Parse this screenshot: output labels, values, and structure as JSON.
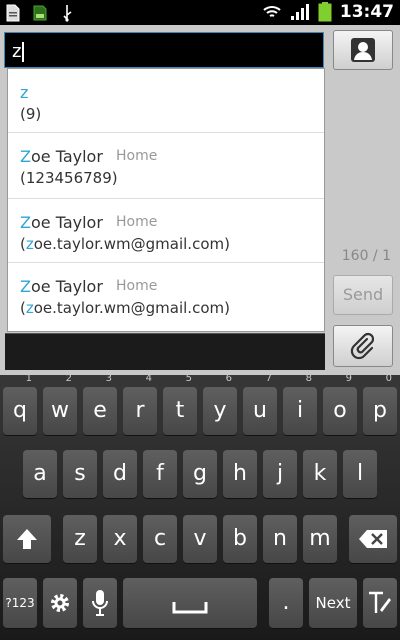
{
  "status_bar": {
    "time": "13:47",
    "icons": [
      "file-icon",
      "sd-card-icon",
      "usb-icon",
      "wifi-icon",
      "signal-icon",
      "battery-icon"
    ],
    "battery_color": "#7fd02f"
  },
  "compose": {
    "to_value": "z",
    "char_counter": "160 / 1",
    "send_label": "Send"
  },
  "suggestions": [
    {
      "match": "z",
      "name_rest": "",
      "type": "",
      "detail": "(9)",
      "detail_highlight": "",
      "detail_rest": ""
    },
    {
      "match": "Z",
      "name_rest": "oe Taylor",
      "type": "Home",
      "detail": "(123456789)",
      "detail_highlight": "",
      "detail_rest": ""
    },
    {
      "match": "Z",
      "name_rest": "oe Taylor",
      "type": "Home",
      "detail": "(",
      "detail_highlight": "z",
      "detail_rest": "oe.taylor.wm@gmail.com)"
    },
    {
      "match": "Z",
      "name_rest": "oe Taylor",
      "type": "Home",
      "detail": "(",
      "detail_highlight": "z",
      "detail_rest": "oe.taylor.wm@gmail.com)"
    }
  ],
  "keyboard": {
    "row1": [
      {
        "k": "q",
        "n": "1"
      },
      {
        "k": "w",
        "n": "2"
      },
      {
        "k": "e",
        "n": "3"
      },
      {
        "k": "r",
        "n": "4"
      },
      {
        "k": "t",
        "n": "5"
      },
      {
        "k": "y",
        "n": "6"
      },
      {
        "k": "u",
        "n": "7"
      },
      {
        "k": "i",
        "n": "8"
      },
      {
        "k": "o",
        "n": "9"
      },
      {
        "k": "p",
        "n": "0"
      }
    ],
    "row2": [
      "a",
      "s",
      "d",
      "f",
      "g",
      "h",
      "j",
      "k",
      "l"
    ],
    "row3": [
      "z",
      "x",
      "c",
      "v",
      "b",
      "n",
      "m"
    ],
    "symbols_label": "?123",
    "period": ".",
    "next_label": "Next"
  }
}
